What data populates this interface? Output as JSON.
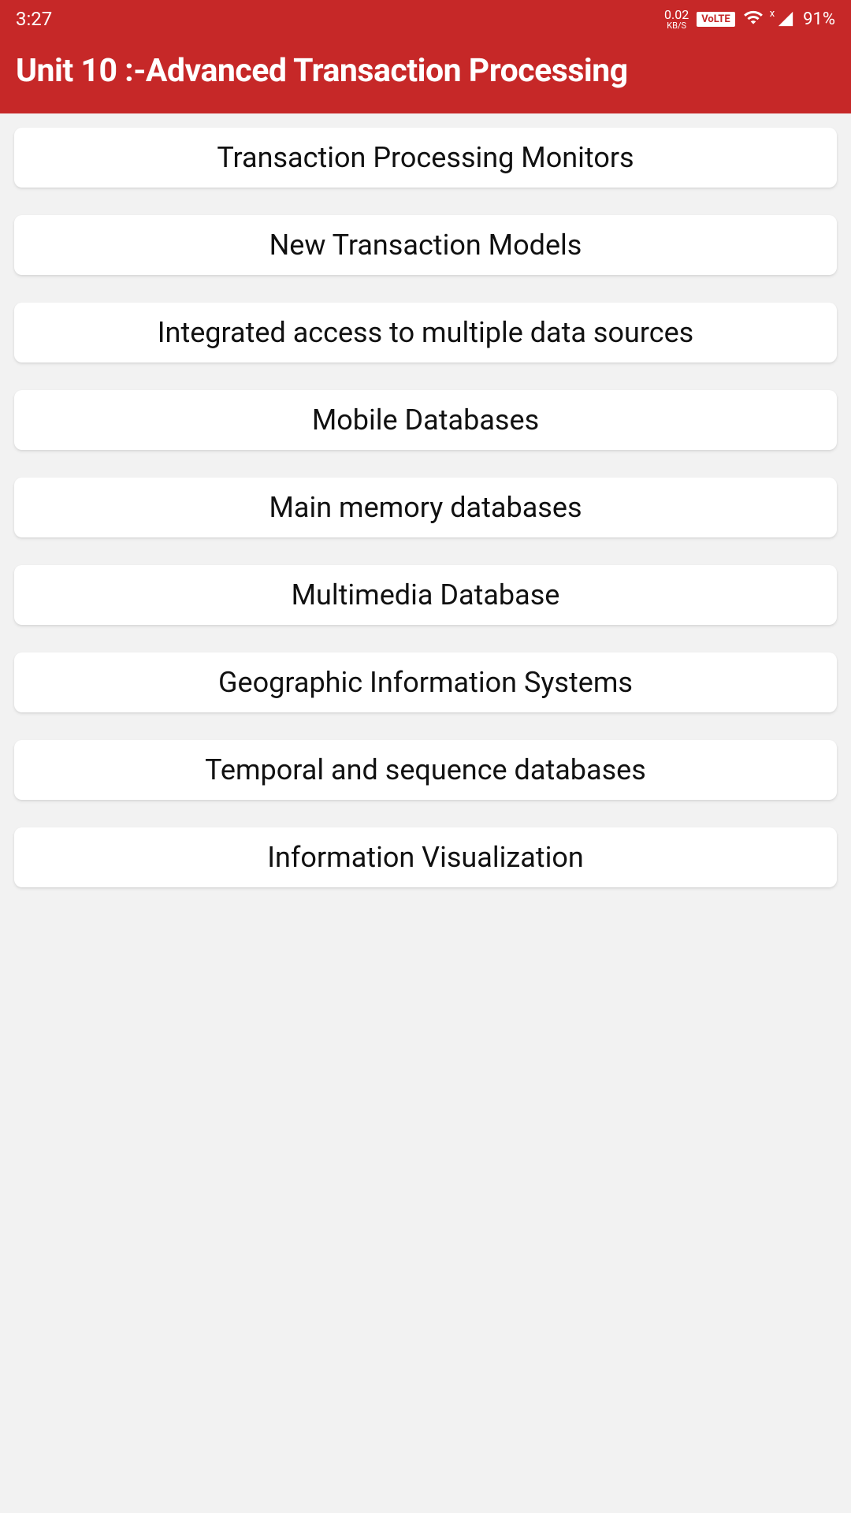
{
  "status_bar": {
    "time": "3:27",
    "data_rate_value": "0.02",
    "data_rate_unit": "KB/S",
    "volte": "VoLTE",
    "signal_x": "x",
    "battery": "91%"
  },
  "header": {
    "title": "Unit 10 :-Advanced Transaction Processing"
  },
  "items": [
    {
      "label": "Transaction Processing Monitors"
    },
    {
      "label": "New Transaction Models"
    },
    {
      "label": "Integrated access to multiple data sources"
    },
    {
      "label": "Mobile Databases"
    },
    {
      "label": "Main memory databases"
    },
    {
      "label": "Multimedia Database"
    },
    {
      "label": "Geographic Information Systems"
    },
    {
      "label": "Temporal and sequence databases"
    },
    {
      "label": "Information Visualization"
    }
  ]
}
